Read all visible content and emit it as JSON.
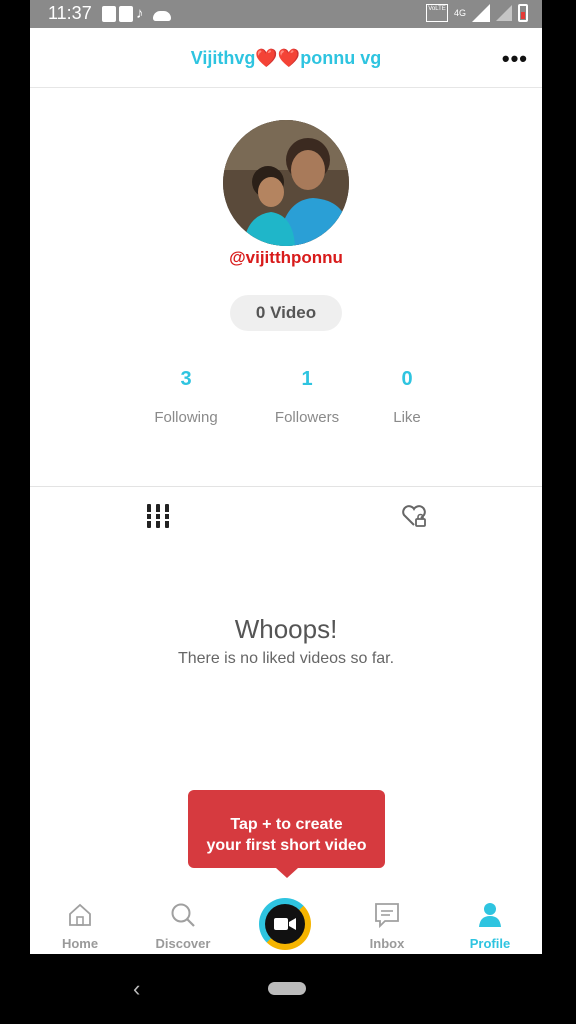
{
  "status_bar": {
    "time": "11:37",
    "network": "4G",
    "icons": [
      "gallery-icon",
      "gallery-icon",
      "tiktok-icon",
      "cloud-icon",
      "volte-icon",
      "signal-icon",
      "battery-icon"
    ]
  },
  "header": {
    "title": "Vijithvg❤️❤️ponnu vg",
    "menu_icon": "more-horizontal-icon"
  },
  "profile": {
    "handle": "@vijitthponnu",
    "video_pill": "0 Video"
  },
  "stats": [
    {
      "value": "3",
      "label": "Following"
    },
    {
      "value": "1",
      "label": "Followers"
    },
    {
      "value": "0",
      "label": "Like"
    }
  ],
  "tabs": {
    "videos_icon": "grid-bars-icon",
    "liked_icon": "heart-lock-icon"
  },
  "empty_state": {
    "title": "Whoops!",
    "message": "There is no liked videos so far."
  },
  "tooltip": {
    "line1": "Tap + to create",
    "line2": "your first short video"
  },
  "bottom_nav": {
    "items": [
      {
        "label": "Home",
        "icon": "home-icon"
      },
      {
        "label": "Discover",
        "icon": "search-icon"
      },
      {
        "label": "",
        "icon": "video-camera-icon"
      },
      {
        "label": "Inbox",
        "icon": "message-icon"
      },
      {
        "label": "Profile",
        "icon": "person-icon"
      }
    ],
    "active": "Profile",
    "accent_color": "#2ec4e0",
    "create_accent_color": "#f5b400"
  },
  "colors": {
    "accent": "#2ec4e0",
    "handle": "#d81b1b",
    "tooltip_bg": "#d63a3f"
  }
}
